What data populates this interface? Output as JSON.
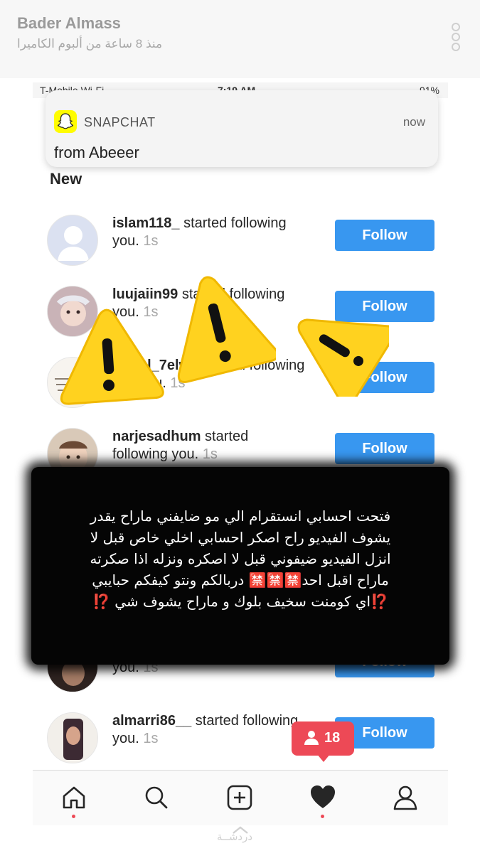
{
  "story": {
    "author": "Bader Almass",
    "subtitle": "منذ 8 ساعة من ألبوم الكاميرا"
  },
  "status_bar": {
    "carrier": "T-Mobile Wi-Fi",
    "time": "7:19 AM",
    "battery": "91%"
  },
  "notification": {
    "app": "SNAPCHAT",
    "time": "now",
    "message": "from Abeeer"
  },
  "section_title": "New",
  "follow_label": "Follow",
  "activity": [
    {
      "user": "islam118_",
      "action": "started following",
      "tail": "you.",
      "time": "1s"
    },
    {
      "user": "luujaiin99",
      "action": "started following",
      "tail": "you.",
      "time": "1s"
    },
    {
      "user": "al_7elwa",
      "action": "started following",
      "tail": "you.",
      "time": "1s"
    },
    {
      "user": "narjesadhum",
      "action": "started",
      "tail": "following you.",
      "time": "1s"
    },
    {
      "user": "",
      "action": "",
      "tail": "you.",
      "time": "1s"
    },
    {
      "user": "almarri86__",
      "action": "started following",
      "tail": "you.",
      "time": "1s"
    }
  ],
  "overlay_text": {
    "line1": "فتحت احسابي انستقرام الي مو ضايفني ماراح يقدر",
    "line2": "يشوف الفيديو راح اصكر احسابي اخلي خاص قبل لا",
    "line3": "انزل الفيديو  ضيفوني قبل لا اصكره ونزله اذا صكرته",
    "line4": "ماراح اقبل احد🈲🈲🈲 دربالكم ونتو كيفكم حبايبي",
    "line5": "⁉️اي كومنت سخيف بلوك و ماراح يشوف شي ⁉️"
  },
  "activity_badge": {
    "count": "18"
  },
  "tabs": [
    "home-icon",
    "search-icon",
    "add-icon",
    "heart-icon",
    "profile-icon"
  ],
  "chat_label": "دردشــة",
  "colors": {
    "follow_blue": "#3897f0",
    "badge_red": "#ed4956",
    "warning_yellow": "#ffd21f",
    "snapchat_yellow": "#fffc00"
  }
}
